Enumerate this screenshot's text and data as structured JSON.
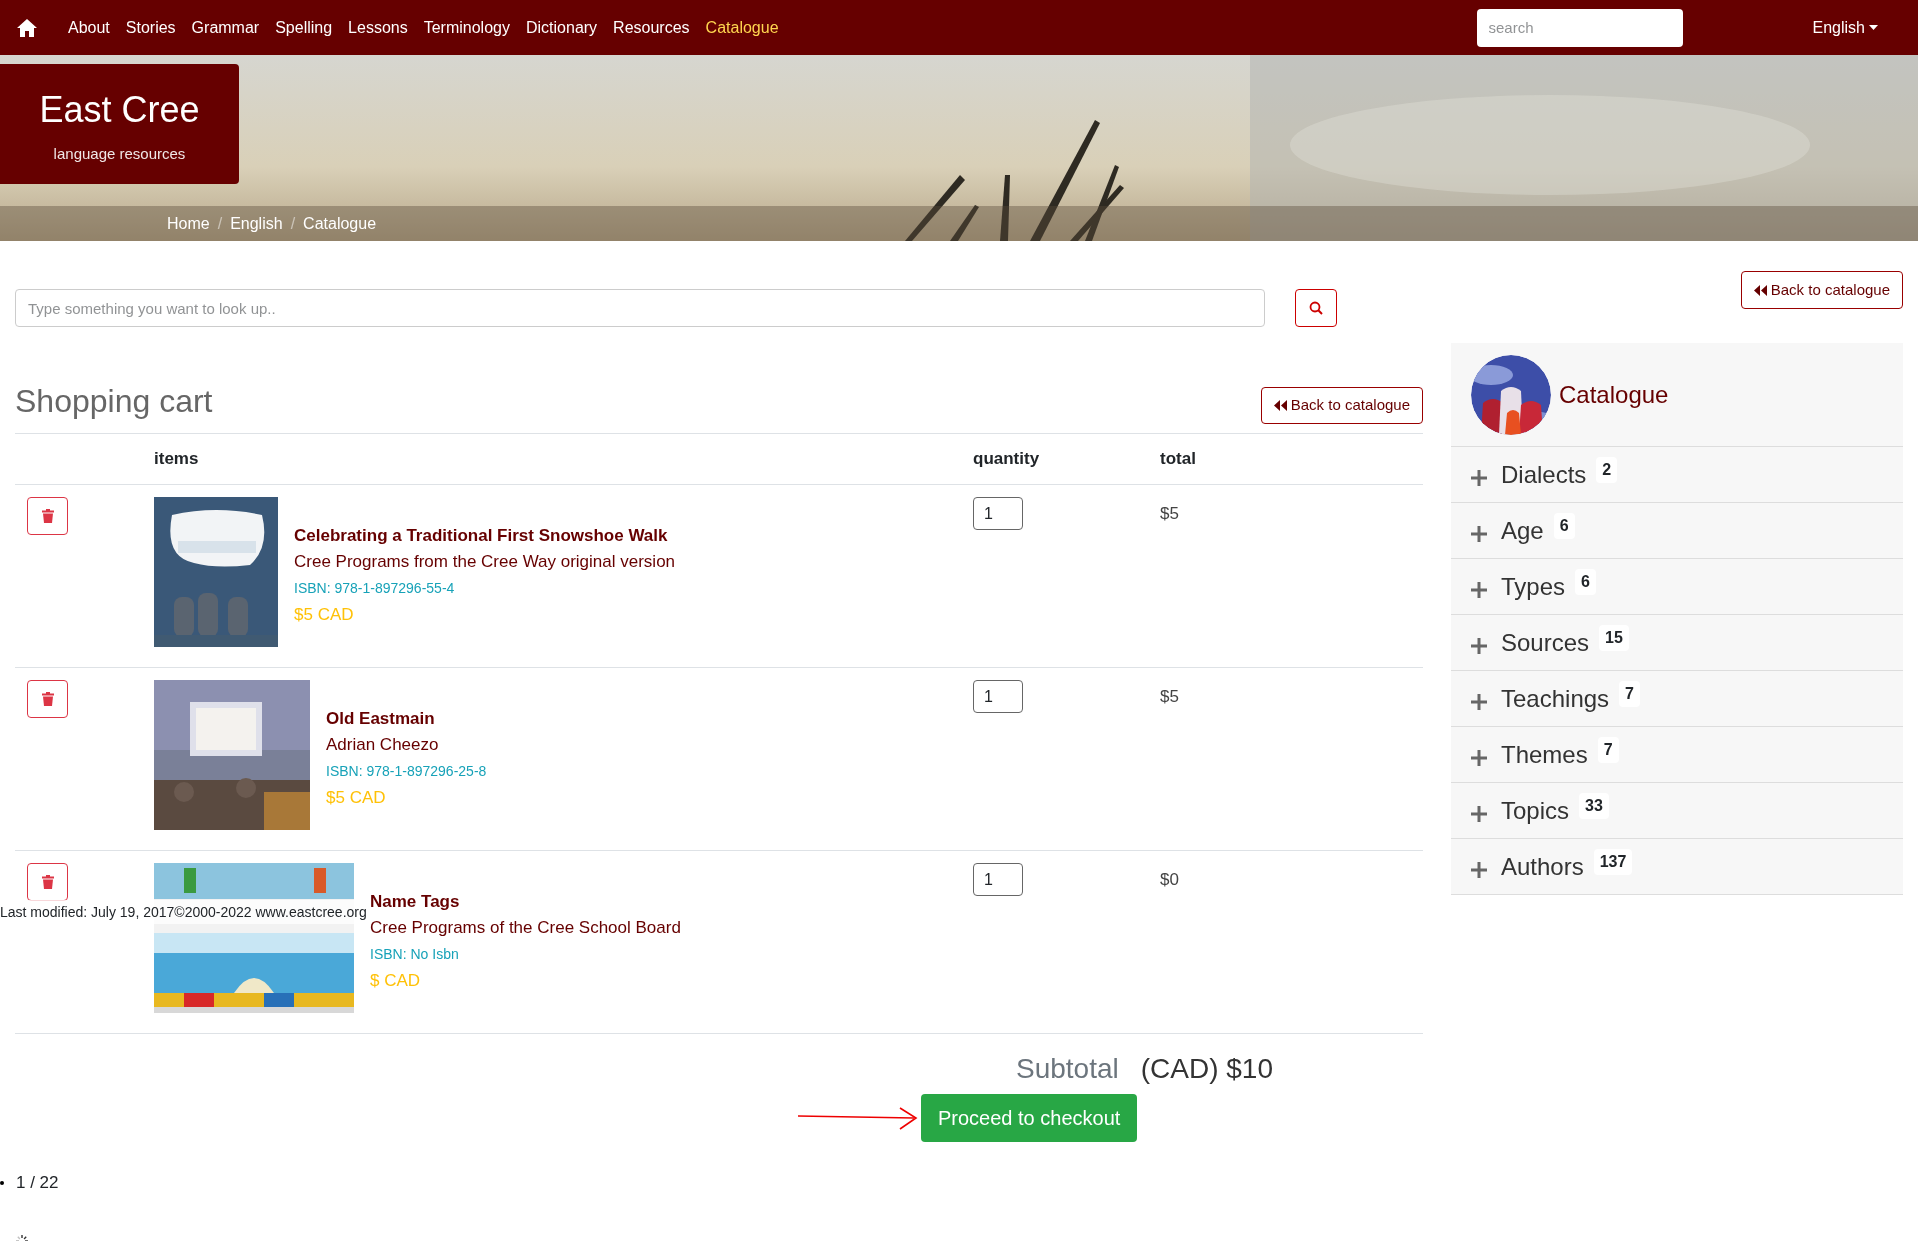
{
  "nav": {
    "links": [
      {
        "label": "About",
        "selected": false
      },
      {
        "label": "Stories",
        "selected": false
      },
      {
        "label": "Grammar",
        "selected": false
      },
      {
        "label": "Spelling",
        "selected": false
      },
      {
        "label": "Lessons",
        "selected": false
      },
      {
        "label": "Terminology",
        "selected": false
      },
      {
        "label": "Dictionary",
        "selected": false
      },
      {
        "label": "Resources",
        "selected": false
      },
      {
        "label": "Catalogue",
        "selected": true
      }
    ],
    "search": {
      "placeholder": "search"
    },
    "language": "English"
  },
  "logo": {
    "title": "East Cree",
    "subtitle": "language resources"
  },
  "breadcrumb": [
    {
      "kind": "link",
      "text": "Home"
    },
    {
      "kind": "separator",
      "text": "/"
    },
    {
      "kind": "link",
      "text": "English"
    },
    {
      "kind": "separator",
      "text": "/"
    },
    {
      "kind": "link",
      "text": "Catalogue"
    }
  ],
  "lookup": {
    "placeholder": "Type something you want to look up.."
  },
  "back_buttons": [
    "Back to catalogue",
    "Back to catalogue"
  ],
  "cart": {
    "title": "Shopping cart",
    "columns": [
      "items",
      "quantity",
      "total"
    ],
    "rows": [
      {
        "title": "Celebrating a Traditional First Snowshoe Walk",
        "subtitle": "Cree Programs from the Cree Way original version",
        "isbn": "ISBN: 978-1-897296-55-4",
        "price": "$5 CAD",
        "quantity": "1",
        "total": "$5"
      },
      {
        "title": "Old Eastmain",
        "subtitle": "Adrian Cheezo",
        "isbn": "ISBN: 978-1-897296-25-8",
        "price": "$5 CAD",
        "quantity": "1",
        "total": "$5"
      },
      {
        "title": "Name Tags",
        "subtitle": "Cree Programs of the Cree School Board",
        "isbn": "ISBN: No Isbn",
        "price": "$ CAD",
        "quantity": "1",
        "total": "$0"
      }
    ],
    "subtotal_label": "Subtotal",
    "subtotal": "(CAD) $10",
    "checkout": "Proceed to checkout"
  },
  "pager": "1 / 22",
  "footer": "Last modified: July 19, 2017©2000-2022 www.eastcree.org",
  "sidebar": {
    "title": "Catalogue",
    "facets": [
      {
        "label": "Dialects",
        "count": "2",
        "expanded": false
      },
      {
        "label": "Age",
        "count": "6",
        "expanded": false
      },
      {
        "label": "Types",
        "count": "6",
        "expanded": false
      },
      {
        "label": "Sources",
        "count": "15",
        "expanded": false
      },
      {
        "label": "Teachings",
        "count": "7",
        "expanded": false
      },
      {
        "label": "Themes",
        "count": "7",
        "expanded": false
      },
      {
        "label": "Topics",
        "count": "33",
        "expanded": false
      },
      {
        "label": "Authors",
        "count": "137",
        "expanded": false
      }
    ]
  }
}
